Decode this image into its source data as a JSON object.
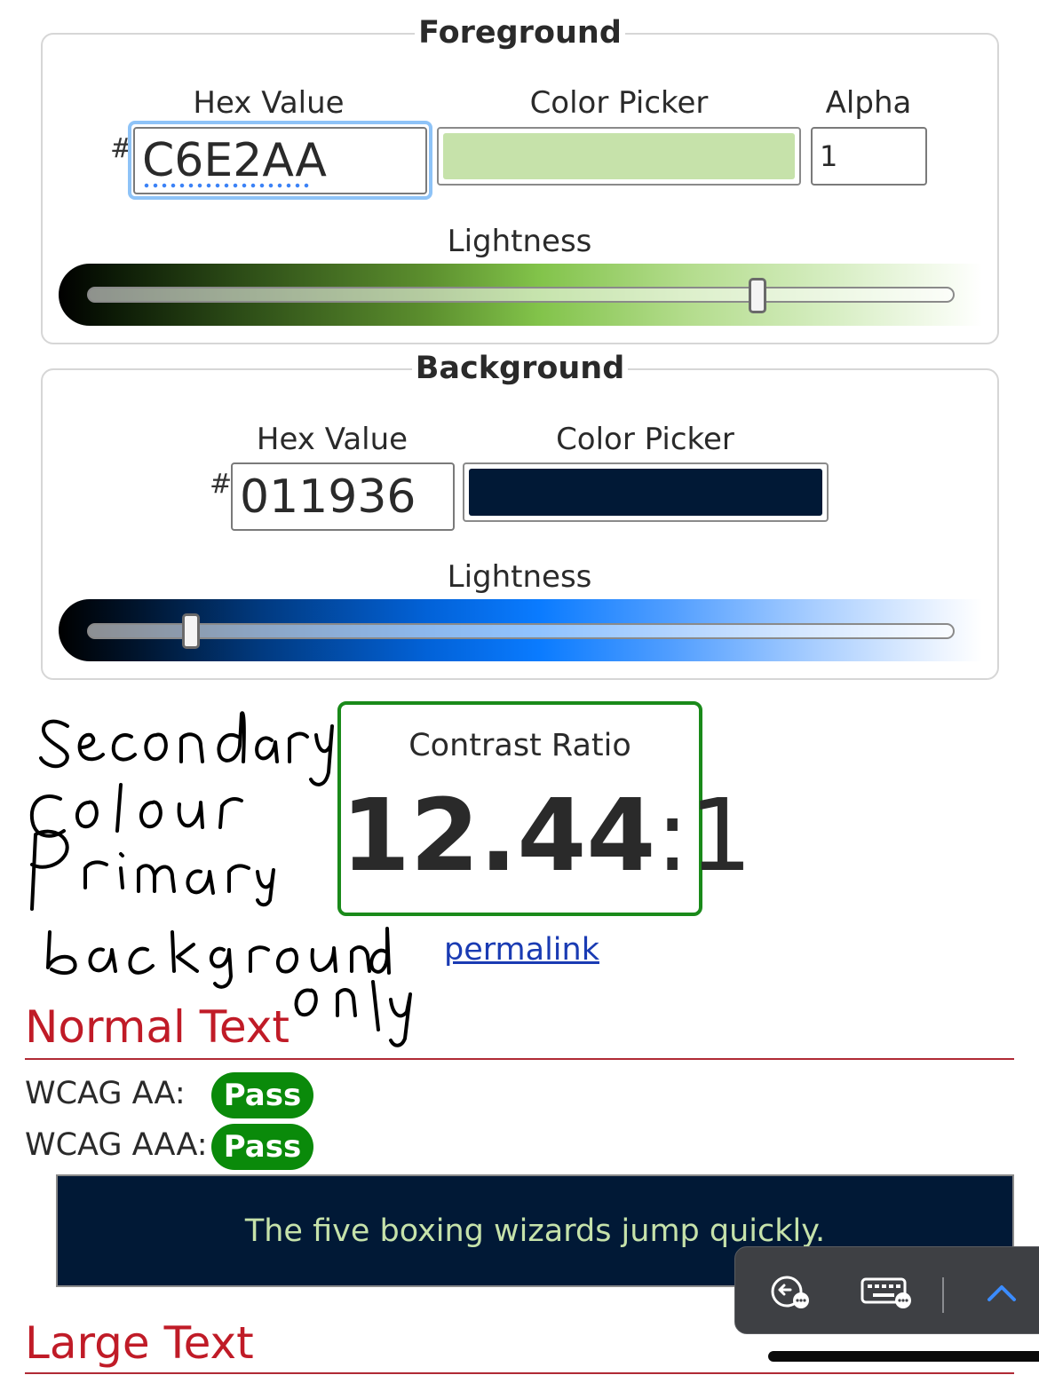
{
  "foreground": {
    "legend": "Foreground",
    "hex_label": "Hex Value",
    "hash": "#",
    "hex_value": "C6E2AA",
    "picker_label": "Color Picker",
    "alpha_label": "Alpha",
    "alpha_value": "1",
    "lightness_label": "Lightness",
    "color": "#C6E2AA",
    "lightness_fraction": 0.77
  },
  "background": {
    "legend": "Background",
    "hex_label": "Hex Value",
    "hash": "#",
    "hex_value": "011936",
    "picker_label": "Color Picker",
    "lightness_label": "Lightness",
    "color": "#011936",
    "lightness_fraction": 0.12
  },
  "contrast": {
    "label": "Contrast Ratio",
    "ratio_main": "12.44",
    "ratio_suffix": ":1",
    "permalink": "permalink"
  },
  "handwriting_note": "Secondary colour Primary background only",
  "normal_text": {
    "title": "Normal Text",
    "aa_label": "WCAG AA:",
    "aa_result": "Pass",
    "aaa_label": "WCAG AAA:",
    "aaa_result": "Pass",
    "sample": "The five boxing wizards jump quickly."
  },
  "large_text": {
    "title": "Large Text"
  },
  "toolbar": {
    "icons": [
      "undo-chat-icon",
      "keyboard-icon",
      "chevron-up-icon"
    ]
  },
  "colors": {
    "pass_green": "#0a8a0a",
    "heading_red": "#c01b27",
    "link_blue": "#1a3bb3"
  }
}
